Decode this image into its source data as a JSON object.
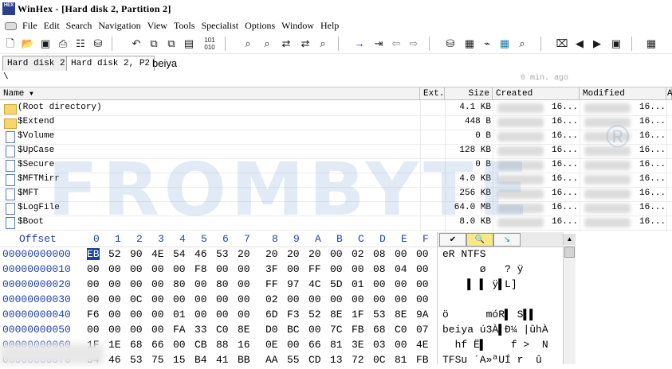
{
  "window": {
    "title": "WinHex - [Hard disk 2, Partition 2]",
    "app_icon_text": "HEX"
  },
  "menu": [
    "File",
    "Edit",
    "Search",
    "Navigation",
    "View",
    "Tools",
    "Specialist",
    "Options",
    "Window",
    "Help"
  ],
  "toolbar_icons": [
    "new-file-icon",
    "open-icon",
    "save-icon",
    "print-icon",
    "properties-icon",
    "open-disk-icon",
    "undo-icon",
    "copy-icon",
    "copy-block-icon",
    "paste-icon",
    "binary-icon",
    "find-text-icon",
    "find-hex-icon",
    "replace-text-icon",
    "replace-hex-icon",
    "find-again-icon",
    "go-to-offset-icon",
    "go-to-sector-icon",
    "back-icon",
    "forward-icon",
    "disk-editor-icon",
    "ram-editor-icon",
    "analyze-icon",
    "calculator-icon",
    "hash-icon",
    "data-interpreter-icon",
    "prev-icon",
    "next-icon",
    "snapshot-icon",
    "grid-icon"
  ],
  "tabs": [
    {
      "label": "Hard disk 2",
      "active": false
    },
    {
      "label": "Hard disk 2, P2",
      "active": true
    },
    {
      "label": "beiya",
      "active": false
    }
  ],
  "path": {
    "text": "\\",
    "age": "0 min. ago"
  },
  "file_list": {
    "columns": {
      "name": "Name",
      "ext": "Ext.",
      "size": "Size",
      "created": "Created",
      "modified": "Modified",
      "extra": "A"
    },
    "rows": [
      {
        "name": "(Root directory)",
        "icon": "folder",
        "size": "4.1 KB",
        "created": "16...",
        "modified": "16..."
      },
      {
        "name": "$Extend",
        "icon": "folder",
        "size": "448 B",
        "created": "16...",
        "modified": "16..."
      },
      {
        "name": "$Volume",
        "icon": "file",
        "size": "0 B",
        "created": "16...",
        "modified": "16..."
      },
      {
        "name": "$UpCase",
        "icon": "file",
        "size": "128 KB",
        "created": "16...",
        "modified": "16..."
      },
      {
        "name": "$Secure",
        "icon": "file",
        "size": "0 B",
        "created": "16...",
        "modified": "16..."
      },
      {
        "name": "$MFTMirr",
        "icon": "file",
        "size": "4.0 KB",
        "created": "16...",
        "modified": "16..."
      },
      {
        "name": "$MFT",
        "icon": "file",
        "size": "256 KB",
        "created": "16...",
        "modified": "16..."
      },
      {
        "name": "$LogFile",
        "icon": "file",
        "size": "64.0 MB",
        "created": "16...",
        "modified": "16..."
      },
      {
        "name": "$Boot",
        "icon": "file",
        "size": "8.0 KB",
        "created": "16...",
        "modified": "16..."
      }
    ]
  },
  "hex": {
    "offset_label": "Offset",
    "columns": [
      "0",
      "1",
      "2",
      "3",
      "4",
      "5",
      "6",
      "7",
      "8",
      "9",
      "A",
      "B",
      "C",
      "D",
      "E",
      "F"
    ],
    "rows": [
      {
        "offset": "00000000000",
        "bytes": [
          "EB",
          "52",
          "90",
          "4E",
          "54",
          "46",
          "53",
          "20",
          "20",
          "20",
          "20",
          "00",
          "02",
          "08",
          "00",
          "00"
        ],
        "text": "eR NTFS"
      },
      {
        "offset": "00000000010",
        "bytes": [
          "00",
          "00",
          "00",
          "00",
          "00",
          "F8",
          "00",
          "00",
          "3F",
          "00",
          "FF",
          "00",
          "00",
          "08",
          "04",
          "00"
        ],
        "text": "      ø   ? ÿ"
      },
      {
        "offset": "00000000020",
        "bytes": [
          "00",
          "00",
          "00",
          "00",
          "80",
          "00",
          "80",
          "00",
          "FF",
          "97",
          "4C",
          "5D",
          "01",
          "00",
          "00",
          "00"
        ],
        "text": "    ▌ ▌ ÿ▌L]"
      },
      {
        "offset": "00000000030",
        "bytes": [
          "00",
          "00",
          "0C",
          "00",
          "00",
          "00",
          "00",
          "00",
          "02",
          "00",
          "00",
          "00",
          "00",
          "00",
          "00",
          "00"
        ],
        "text": ""
      },
      {
        "offset": "00000000040",
        "bytes": [
          "F6",
          "00",
          "00",
          "00",
          "01",
          "00",
          "00",
          "00",
          "6D",
          "F3",
          "52",
          "8E",
          "1F",
          "53",
          "8E",
          "9A"
        ],
        "text": "ö      móR▌ S▌▌"
      },
      {
        "offset": "00000000050",
        "bytes": [
          "00",
          "00",
          "00",
          "00",
          "FA",
          "33",
          "C0",
          "8E",
          "D0",
          "BC",
          "00",
          "7C",
          "FB",
          "68",
          "C0",
          "07"
        ],
        "text": "beiya ú3À▌Ð¼ |ûhÀ"
      },
      {
        "offset": "00000000060",
        "bytes": [
          "1F",
          "1E",
          "68",
          "66",
          "00",
          "CB",
          "88",
          "16",
          "0E",
          "00",
          "66",
          "81",
          "3E",
          "03",
          "00",
          "4E"
        ],
        "text": "  hf Ë▌    f >  N"
      },
      {
        "offset": "00000000070",
        "bytes": [
          "54",
          "46",
          "53",
          "75",
          "15",
          "B4",
          "41",
          "BB",
          "AA",
          "55",
          "CD",
          "13",
          "72",
          "0C",
          "81",
          "FB"
        ],
        "text": "TFSu ´A»ªUÍ r  û"
      }
    ],
    "text_tabs": [
      "check-icon",
      "magnify-icon",
      "arrow-icon"
    ]
  },
  "watermark": {
    "text": "FROMBYTE",
    "mark": "®"
  }
}
